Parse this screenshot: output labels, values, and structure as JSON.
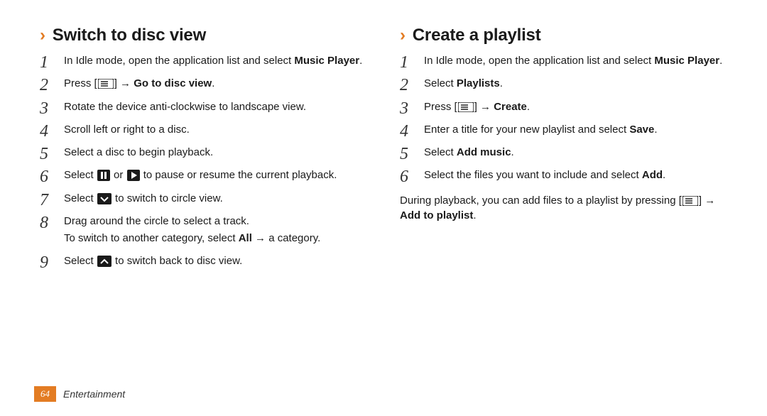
{
  "page_number": "64",
  "section_label": "Entertainment",
  "left": {
    "heading": "Switch to disc view",
    "steps": [
      {
        "parts": [
          {
            "t": "In Idle mode, open the application list and select "
          },
          {
            "b": "Music Player"
          },
          {
            "t": "."
          }
        ]
      },
      {
        "parts": [
          {
            "t": "Press ["
          },
          {
            "icon": "menu-icon"
          },
          {
            "t": "] → "
          },
          {
            "b": "Go to disc view"
          },
          {
            "t": "."
          }
        ]
      },
      {
        "parts": [
          {
            "t": "Rotate the device anti-clockwise to landscape view."
          }
        ]
      },
      {
        "parts": [
          {
            "t": "Scroll left or right to a disc."
          }
        ]
      },
      {
        "parts": [
          {
            "t": "Select a disc to begin playback."
          }
        ]
      },
      {
        "parts": [
          {
            "t": "Select "
          },
          {
            "icon": "pause-icon"
          },
          {
            "t": " or "
          },
          {
            "icon": "play-icon"
          },
          {
            "t": " to pause or resume the current playback."
          }
        ]
      },
      {
        "parts": [
          {
            "t": "Select "
          },
          {
            "icon": "circle-view-icon"
          },
          {
            "t": " to switch to circle view."
          }
        ]
      },
      {
        "parts": [
          {
            "t": "Drag around the circle to select a track."
          }
        ],
        "extra": [
          {
            "t": "To switch to another category, select "
          },
          {
            "b": "All"
          },
          {
            "t": " → a category."
          }
        ]
      },
      {
        "parts": [
          {
            "t": "Select "
          },
          {
            "icon": "disc-view-icon"
          },
          {
            "t": " to switch back to disc view."
          }
        ]
      }
    ]
  },
  "right": {
    "heading": "Create a playlist",
    "steps": [
      {
        "parts": [
          {
            "t": "In Idle mode, open the application list and select "
          },
          {
            "b": "Music Player"
          },
          {
            "t": "."
          }
        ]
      },
      {
        "parts": [
          {
            "t": "Select "
          },
          {
            "b": "Playlists"
          },
          {
            "t": "."
          }
        ]
      },
      {
        "parts": [
          {
            "t": "Press ["
          },
          {
            "icon": "menu-icon"
          },
          {
            "t": "] → "
          },
          {
            "b": "Create"
          },
          {
            "t": "."
          }
        ]
      },
      {
        "parts": [
          {
            "t": "Enter a title for your new playlist and select "
          },
          {
            "b": "Save"
          },
          {
            "t": "."
          }
        ]
      },
      {
        "parts": [
          {
            "t": "Select "
          },
          {
            "b": "Add music"
          },
          {
            "t": "."
          }
        ]
      },
      {
        "parts": [
          {
            "t": "Select the files you want to include and select "
          },
          {
            "b": "Add"
          },
          {
            "t": "."
          }
        ]
      }
    ],
    "after": {
      "parts": [
        {
          "t": "During playback, you can add files to a playlist by pressing ["
        },
        {
          "icon": "menu-icon"
        },
        {
          "t": "] → "
        },
        {
          "b": "Add to playlist"
        },
        {
          "t": "."
        }
      ]
    }
  },
  "icons": {
    "menu-icon": "menu",
    "pause-icon": "pause",
    "play-icon": "play",
    "circle-view-icon": "chevdown",
    "disc-view-icon": "chevup"
  }
}
